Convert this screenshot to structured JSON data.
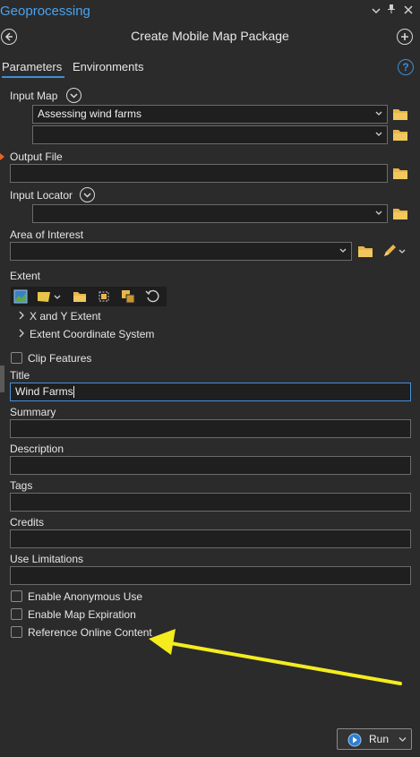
{
  "pane": {
    "title": "Geoprocessing"
  },
  "tool": {
    "title": "Create Mobile Map Package"
  },
  "tabs": [
    {
      "label": "Parameters",
      "active": true
    },
    {
      "label": "Environments",
      "active": false
    }
  ],
  "params": {
    "input_map": {
      "label": "Input Map",
      "value": "Assessing wind farms",
      "value2": ""
    },
    "output_file": {
      "label": "Output File",
      "value": ""
    },
    "input_locator": {
      "label": "Input Locator",
      "value": ""
    },
    "area_of_interest": {
      "label": "Area of Interest",
      "value": ""
    },
    "extent": {
      "label": "Extent",
      "xy_extent": "X and Y Extent",
      "coord_system": "Extent Coordinate System"
    },
    "clip_features": {
      "label": "Clip Features",
      "checked": false
    },
    "title": {
      "label": "Title",
      "value": "Wind Farms"
    },
    "summary": {
      "label": "Summary",
      "value": ""
    },
    "description": {
      "label": "Description",
      "value": ""
    },
    "tags": {
      "label": "Tags",
      "value": ""
    },
    "credits": {
      "label": "Credits",
      "value": ""
    },
    "use_limitations": {
      "label": "Use Limitations",
      "value": ""
    },
    "enable_anonymous": {
      "label": "Enable Anonymous Use",
      "checked": false
    },
    "enable_expiration": {
      "label": "Enable Map Expiration",
      "checked": false
    },
    "reference_online": {
      "label": "Reference Online Content",
      "checked": false
    }
  },
  "run": {
    "label": "Run"
  },
  "colors": {
    "accent": "#3d8fd6",
    "title_blue": "#4aa3f0",
    "annotation_arrow": "#f4ec1e",
    "required_marker": "#e5641e",
    "folder": "#e8b64a"
  },
  "icons": [
    "back-icon",
    "add-icon",
    "help-icon",
    "chevron-down-icon",
    "folder-icon",
    "pencil-icon",
    "map-extent-icon",
    "layer-extent-icon",
    "browse-folder-icon",
    "select-extent-icon",
    "copy-extent-icon",
    "reset-icon",
    "run-icon"
  ]
}
